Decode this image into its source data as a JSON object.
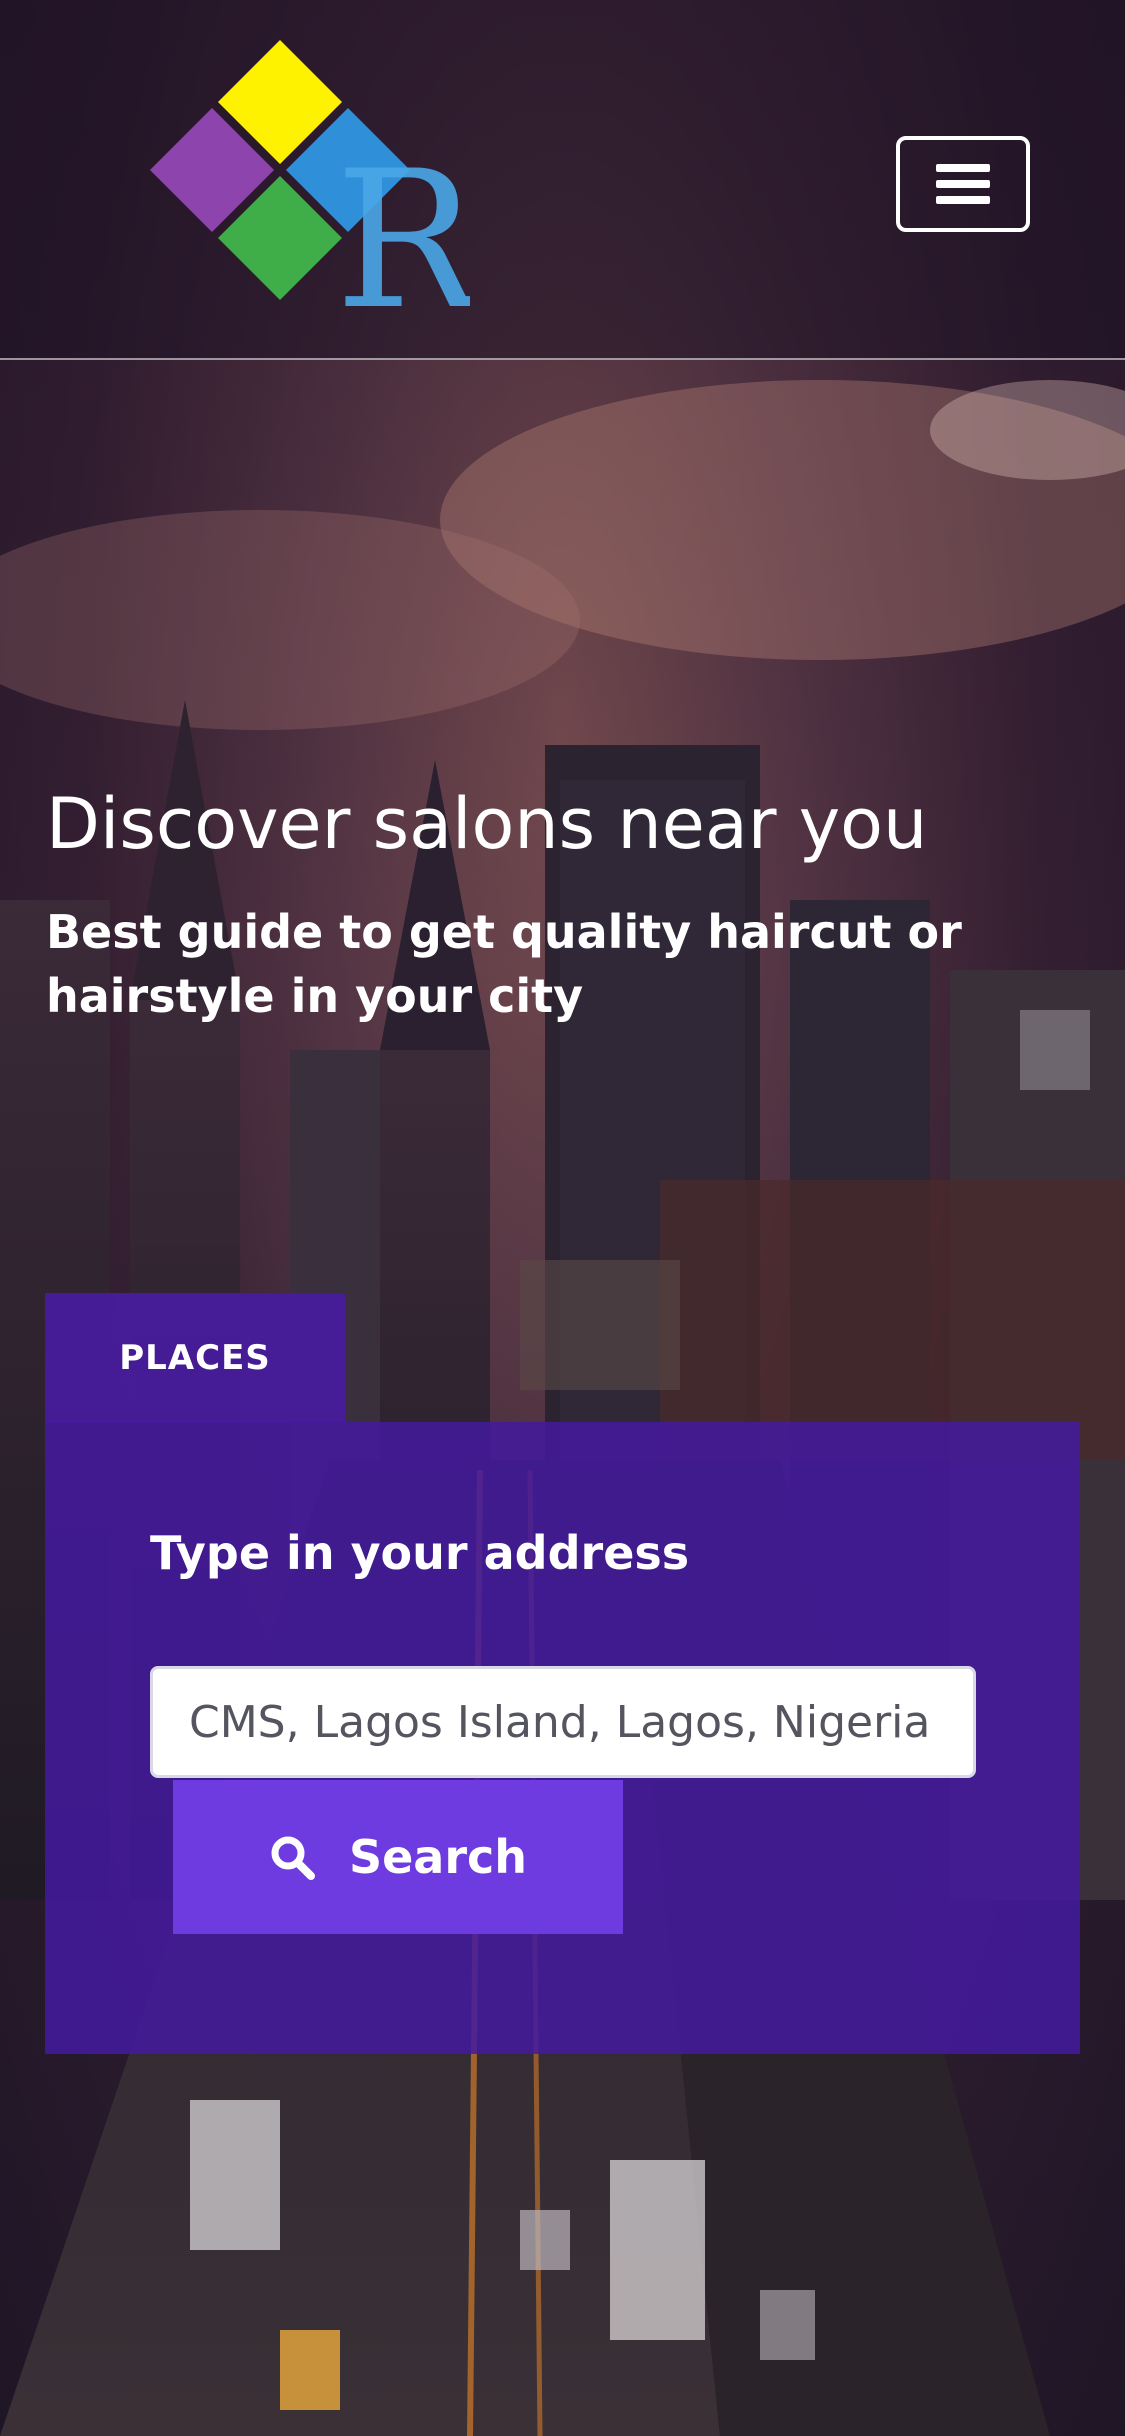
{
  "brand": {
    "logo_letter": "R",
    "colors": {
      "yellow": "#fff200",
      "purple": "#8e44ad",
      "green": "#3fae49",
      "blue": "#2f8fd8"
    }
  },
  "header": {
    "menu_icon": "hamburger-menu-icon"
  },
  "hero": {
    "title": "Discover salons near you",
    "subtitle": "Best guide to get quality haircut or hairstyle in your city"
  },
  "search": {
    "tab_label": "PLACES",
    "panel_label": "Type in your address",
    "input_value": "CMS, Lagos Island, Lagos, Nigeria",
    "button_label": "Search",
    "button_icon": "search-icon",
    "accent_color": "#6d3be0"
  }
}
